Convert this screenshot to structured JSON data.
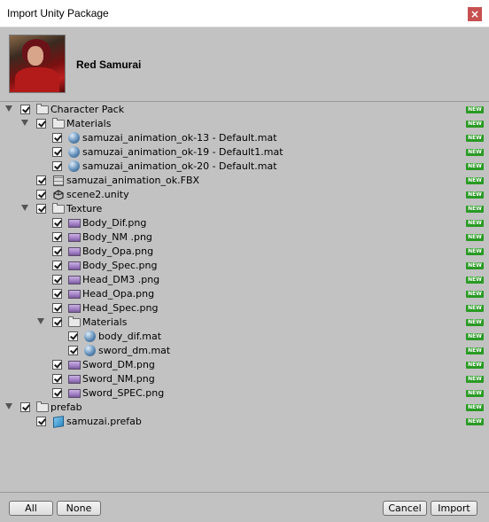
{
  "window": {
    "title": "Import Unity Package",
    "close_glyph": "×"
  },
  "package": {
    "name": "Red Samurai"
  },
  "badge_text": "NEW",
  "tree": [
    {
      "label": "Character Pack",
      "icon": "folder",
      "foldout": true
    },
    {
      "label": "Materials",
      "icon": "folder",
      "foldout": true
    },
    {
      "label": "samuzai_animation_ok-13 - Default.mat",
      "icon": "material"
    },
    {
      "label": "samuzai_animation_ok-19 - Default1.mat",
      "icon": "material"
    },
    {
      "label": "samuzai_animation_ok-20 - Default.mat",
      "icon": "material"
    },
    {
      "label": "samuzai_animation_ok.FBX",
      "icon": "fbx"
    },
    {
      "label": "scene2.unity",
      "icon": "unity-scene"
    },
    {
      "label": "Texture",
      "icon": "folder",
      "foldout": true
    },
    {
      "label": "Body_Dif.png",
      "icon": "texture"
    },
    {
      "label": "Body_NM .png",
      "icon": "texture"
    },
    {
      "label": "Body_Opa.png",
      "icon": "texture"
    },
    {
      "label": "Body_Spec.png",
      "icon": "texture"
    },
    {
      "label": "Head_DM3 .png",
      "icon": "texture"
    },
    {
      "label": "Head_Opa.png",
      "icon": "texture"
    },
    {
      "label": "Head_Spec.png",
      "icon": "texture"
    },
    {
      "label": "Materials",
      "icon": "folder",
      "foldout": true
    },
    {
      "label": "body_dif.mat",
      "icon": "material"
    },
    {
      "label": "sword_dm.mat",
      "icon": "material"
    },
    {
      "label": "Sword_DM.png",
      "icon": "texture"
    },
    {
      "label": "Sword_NM.png",
      "icon": "texture"
    },
    {
      "label": "Sword_SPEC.png",
      "icon": "texture"
    },
    {
      "label": "prefab",
      "icon": "folder",
      "foldout": true
    },
    {
      "label": "samuzai.prefab",
      "icon": "prefab"
    }
  ],
  "buttons": {
    "all": "All",
    "none": "None",
    "cancel": "Cancel",
    "import": "Import"
  }
}
